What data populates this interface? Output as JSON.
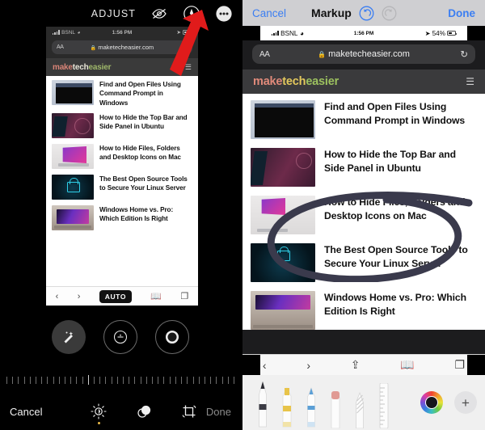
{
  "left": {
    "toolbar": {
      "adjust_label": "ADJUST",
      "hide_markup_icon": "eye-slash-icon",
      "markup_icon": "markup-pen-icon",
      "more_icon": "more-ellipsis-icon"
    },
    "phone": {
      "status": {
        "carrier": "BSNL",
        "time": "1:56 PM",
        "battery": ""
      },
      "browser": {
        "aa_label": "AA",
        "url": "maketecheasier.com",
        "reload_icon": "reload-icon",
        "lock_icon": "lock-icon"
      },
      "site": {
        "logo_part1": "make",
        "logo_part2": "tech",
        "logo_part3": "easier",
        "menu_icon": "hamburger-icon"
      },
      "articles": [
        {
          "title": "Find and Open Files Using Command Prompt in Windows",
          "thumb": "command-prompt-thumbnail"
        },
        {
          "title": "How to Hide the Top Bar and Side Panel in Ubuntu",
          "thumb": "ubuntu-desktop-thumbnail"
        },
        {
          "title": "How to Hide Files, Folders and Desktop Icons on Mac",
          "thumb": "macbook-thumbnail"
        },
        {
          "title": "The Best Open Source Tools to Secure Your Linux Server",
          "thumb": "padlock-thumbnail"
        },
        {
          "title": "Windows Home vs. Pro: Which Edition Is Right",
          "thumb": "laptop-thumbnail"
        }
      ],
      "safari_bottom": {
        "back_icon": "chevron-left-icon",
        "forward_icon": "chevron-right-icon",
        "auto_label": "AUTO",
        "bookmarks_icon": "book-icon",
        "tabs_icon": "tabs-icon"
      }
    },
    "adjust_circles": [
      {
        "name": "auto-enhance-wand",
        "selected": true
      },
      {
        "name": "exposure-adjust",
        "selected": false
      },
      {
        "name": "contrast-adjust",
        "selected": false
      }
    ],
    "bottom": {
      "cancel_label": "Cancel",
      "done_label": "Done",
      "tools": [
        {
          "name": "adjust-tool",
          "active": true
        },
        {
          "name": "filters-tool",
          "active": false
        },
        {
          "name": "crop-tool",
          "active": false
        }
      ]
    },
    "annotation": {
      "arrow": "red-arrow-pointing-to-markup-icon",
      "color": "#e01b1b"
    }
  },
  "right": {
    "toolbar": {
      "cancel_label": "Cancel",
      "title": "Markup",
      "undo_icon": "undo-icon",
      "redo_icon": "redo-icon",
      "done_label": "Done",
      "undo_color": "#3b7ef2",
      "redo_color": "#b6b6b9"
    },
    "phone": {
      "status": {
        "carrier": "BSNL",
        "time": "1:56 PM",
        "battery_pct": "54%"
      },
      "browser": {
        "aa_label": "AA",
        "url": "maketecheasier.com",
        "reload_icon": "reload-icon",
        "lock_icon": "lock-icon"
      },
      "site": {
        "logo_part1": "make",
        "logo_part2": "tech",
        "logo_part3": "easier",
        "menu_icon": "hamburger-icon"
      },
      "articles": [
        {
          "title": "Find and Open Files Using Command Prompt in Windows",
          "thumb": "command-prompt-thumbnail"
        },
        {
          "title": "How to Hide the Top Bar and Side Panel in Ubuntu",
          "thumb": "ubuntu-desktop-thumbnail"
        },
        {
          "title": "How to Hide Files, Folders and Desktop Icons on Mac",
          "thumb": "macbook-thumbnail"
        },
        {
          "title": "The Best Open Source Tools to Secure Your Linux Server",
          "thumb": "padlock-thumbnail"
        },
        {
          "title": "Windows Home vs. Pro: Which Edition Is Right",
          "thumb": "laptop-thumbnail"
        }
      ],
      "safari_bottom": {
        "back_icon": "chevron-left-icon",
        "forward_icon": "chevron-right-icon",
        "share_icon": "share-icon",
        "bookmarks_icon": "book-icon",
        "tabs_icon": "tabs-icon"
      }
    },
    "annotation": {
      "shape": "hand-drawn-circle-around-mac-article",
      "color": "#3a3a4c"
    },
    "palette": {
      "tools": [
        {
          "name": "pen-tool",
          "color": "#3b3b44"
        },
        {
          "name": "highlighter-tool",
          "color": "#e8c44a"
        },
        {
          "name": "marker-tool",
          "color": "#5b9fd6"
        },
        {
          "name": "eraser-tool",
          "color": "#e09a94"
        },
        {
          "name": "lasso-tool",
          "color": "#d8d8d8"
        },
        {
          "name": "ruler-tool",
          "color": "#dcdcdc"
        }
      ],
      "color_wheel": "color-picker-wheel",
      "add_button": "+"
    }
  }
}
